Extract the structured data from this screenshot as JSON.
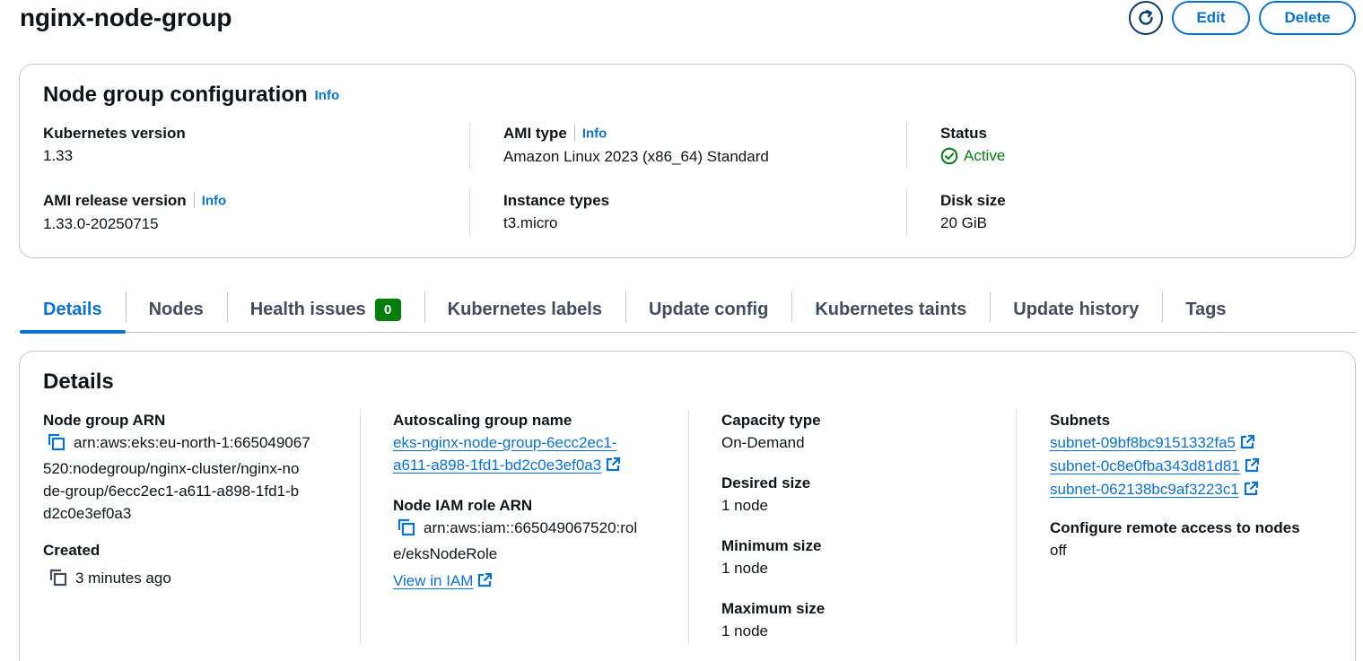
{
  "page": {
    "title": "nginx-node-group",
    "refresh_label": "Refresh",
    "edit_label": "Edit",
    "delete_label": "Delete"
  },
  "config": {
    "title": "Node group configuration",
    "info": "Info",
    "fields": {
      "k8s_version": {
        "label": "Kubernetes version",
        "value": "1.33"
      },
      "ami_type": {
        "label": "AMI type",
        "info": "Info",
        "value": "Amazon Linux 2023 (x86_64) Standard"
      },
      "status": {
        "label": "Status",
        "value": "Active"
      },
      "ami_release": {
        "label": "AMI release version",
        "info": "Info",
        "value": "1.33.0-20250715"
      },
      "instance_types": {
        "label": "Instance types",
        "value": "t3.micro"
      },
      "disk_size": {
        "label": "Disk size",
        "value": "20 GiB"
      }
    }
  },
  "tabs": [
    {
      "label": "Details",
      "active": true
    },
    {
      "label": "Nodes"
    },
    {
      "label": "Health issues",
      "count": "0"
    },
    {
      "label": "Kubernetes labels"
    },
    {
      "label": "Update config"
    },
    {
      "label": "Kubernetes taints"
    },
    {
      "label": "Update history"
    },
    {
      "label": "Tags"
    }
  ],
  "details": {
    "title": "Details",
    "arn": {
      "label": "Node group ARN",
      "lines": [
        "arn:aws:eks:eu-north-1:665049067",
        "520:nodegroup/nginx-cluster/nginx-no",
        "de-group/6ecc2ec1-a611-a898-1fd1-b",
        "d2c0e3ef0a3"
      ]
    },
    "created": {
      "label": "Created",
      "value": "3 minutes ago"
    },
    "asg": {
      "label": "Autoscaling group name",
      "lines": [
        "eks-nginx-node-group-6ecc2ec1-",
        "a611-a898-1fd1-bd2c0e3ef0a3"
      ]
    },
    "iam": {
      "label": "Node IAM role ARN",
      "lines": [
        "arn:aws:iam::665049067520:rol",
        "e/eksNodeRole"
      ],
      "view_link": "View in IAM"
    },
    "capacity": {
      "label": "Capacity type",
      "value": "On-Demand"
    },
    "desired": {
      "label": "Desired size",
      "value": "1 node"
    },
    "minimum": {
      "label": "Minimum size",
      "value": "1 node"
    },
    "maximum": {
      "label": "Maximum size",
      "value": "1 node"
    },
    "subnets": {
      "label": "Subnets",
      "items": [
        "subnet-09bf8bc9151332fa5",
        "subnet-0c8e0fba343d81d81",
        "subnet-062138bc9af3223c1"
      ]
    },
    "remote": {
      "label": "Configure remote access to nodes",
      "value": "off"
    }
  }
}
